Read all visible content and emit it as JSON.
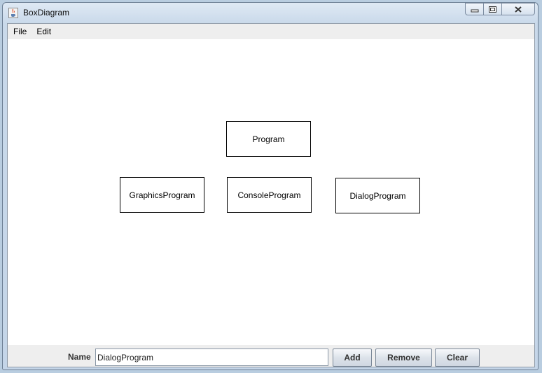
{
  "window": {
    "title": "BoxDiagram",
    "app_icon": "java-cup-icon",
    "caption_buttons": [
      "minimize-icon",
      "restore-icon",
      "close-icon"
    ]
  },
  "menubar": {
    "items": [
      {
        "label": "File"
      },
      {
        "label": "Edit"
      }
    ]
  },
  "diagram": {
    "boxes": [
      {
        "label": "Program"
      },
      {
        "label": "GraphicsProgram"
      },
      {
        "label": "ConsoleProgram"
      },
      {
        "label": "DialogProgram"
      }
    ]
  },
  "controls": {
    "name_label": "Name",
    "name_value": "DialogProgram",
    "add_label": "Add",
    "remove_label": "Remove",
    "clear_label": "Clear"
  }
}
